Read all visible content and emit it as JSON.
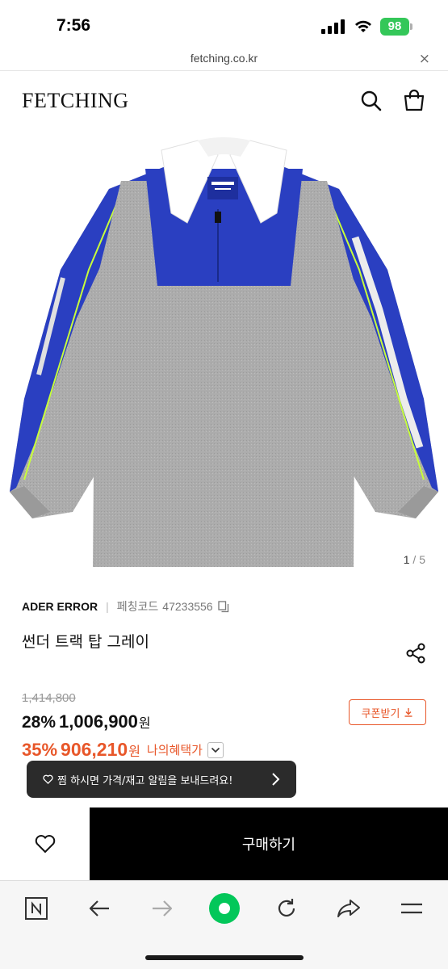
{
  "status_bar": {
    "time": "7:56",
    "battery": "98"
  },
  "browser": {
    "url": "fetching.co.kr",
    "close_label": "×"
  },
  "header": {
    "logo": "FETCHING",
    "icons": [
      "search-icon",
      "shopping-bag-icon"
    ]
  },
  "gallery": {
    "current": "1",
    "separator": "/",
    "total": "5"
  },
  "product": {
    "brand": "ADER ERROR",
    "separator": "|",
    "code_label": "페칭코드",
    "code": "47233556",
    "title": "썬더 트랙 탑 그레이",
    "original_price": "1,414,800",
    "discount_percent": "28%",
    "price": "1,006,900",
    "currency": "원",
    "benefit_percent": "35%",
    "benefit_price": "906,210",
    "benefit_label": "나의혜택가"
  },
  "coupon": {
    "label": "쿠폰받기"
  },
  "toast": {
    "message": "찜 하시면 가격/재고 알림을 보내드려요!"
  },
  "actions": {
    "buy_label": "구매하기"
  },
  "toolbar": {
    "items": [
      "naver-n-icon",
      "back-arrow-icon",
      "forward-arrow-icon",
      "home-circle-icon",
      "reload-icon",
      "share-icon",
      "menu-icon"
    ]
  },
  "colors": {
    "accent": "#e8572a",
    "buy_button": "#000000",
    "battery": "#34c759",
    "toast_bg": "#2b2b2b",
    "naver_green": "#03c75a",
    "jacket_blue": "#2a3fc1",
    "jacket_grey": "#a9a9a9"
  }
}
